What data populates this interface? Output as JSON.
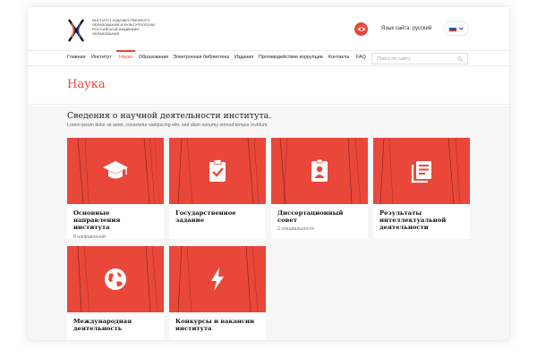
{
  "header": {
    "logo_lines": [
      "ИНСТИТУТ ХУДОЖЕСТВЕННОГО",
      "ОБРАЗОВАНИЯ И КУЛЬТУРОЛОГИИ",
      "РОССИЙСКОЙ АКАДЕМИИ",
      "ОБРАЗОВАНИЯ"
    ],
    "language_label": "Язык сайта: русский"
  },
  "nav": {
    "items": [
      {
        "label": "Главная"
      },
      {
        "label": "Институт"
      },
      {
        "label": "Наука",
        "active": true
      },
      {
        "label": "Образование"
      },
      {
        "label": "Электронная библиотека"
      },
      {
        "label": "Издания"
      },
      {
        "label": "Противодействие коррупции"
      },
      {
        "label": "Контакты"
      },
      {
        "label": "FAQ"
      }
    ],
    "search_placeholder": "Поиск по сайту"
  },
  "page": {
    "title": "Наука",
    "section_title": "Сведения о научной деятельности института.",
    "section_subtitle": "Lorem ipsum dolor sit amet, consetetur sadipscing elitr, sed diam nonumy eirmod tempor invidunt."
  },
  "cards": [
    {
      "icon": "graduation-cap-icon",
      "title": "Основные направления института",
      "meta": "8 направлений"
    },
    {
      "icon": "clipboard-check-icon",
      "title": "Государственное задание",
      "meta": ""
    },
    {
      "icon": "id-badge-icon",
      "title": "Диссертационный совет",
      "meta": "2 специальности"
    },
    {
      "icon": "publications-icon",
      "title": "Результаты интеллектуальной деятельности",
      "meta": ""
    },
    {
      "icon": "globe-icon",
      "title": "Международная деятельность",
      "meta": ""
    },
    {
      "icon": "lightning-icon",
      "title": "Конкурсы и вакансии института",
      "meta": ""
    }
  ],
  "colors": {
    "accent": "#e8483a",
    "section_bg": "#f6f6f6"
  }
}
